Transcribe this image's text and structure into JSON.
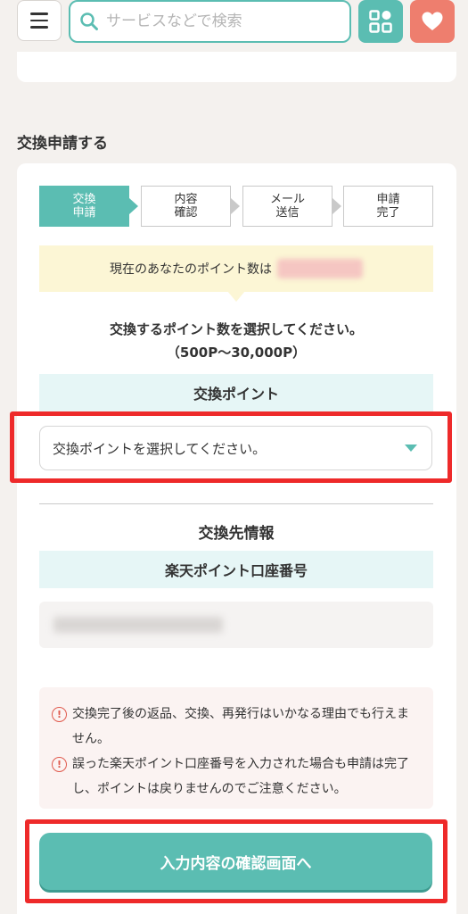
{
  "header": {
    "search_placeholder": "サービスなどで検索"
  },
  "section_title": "交換申請する",
  "steps": [
    {
      "label": "交換\n申請",
      "active": true
    },
    {
      "label": "内容\n確認",
      "active": false
    },
    {
      "label": "メール\n送信",
      "active": false
    },
    {
      "label": "申請\n完了",
      "active": false
    }
  ],
  "points_info": {
    "label": "現在のあなたのポイント数は"
  },
  "instruction": {
    "line1": "交換するポイント数を選択してください。",
    "line2": "（500P〜30,000P）"
  },
  "exchange_points": {
    "heading": "交換ポイント",
    "select_value": "交換ポイントを選択してください。"
  },
  "destination": {
    "title": "交換先情報",
    "field_heading": "楽天ポイント口座番号"
  },
  "notices": [
    "交換完了後の返品、交換、再発行はいかなる理由でも行えません。",
    "誤った楽天ポイント口座番号を入力された場合も申請は完了し、ポイントは戻りませんのでご注意ください。"
  ],
  "submit_label": "入力内容の確認画面へ",
  "colors": {
    "accent": "#5bbdb2",
    "favorite": "#ee7e6e",
    "highlight": "#ee2a2a",
    "background": "#f4f1ee"
  }
}
